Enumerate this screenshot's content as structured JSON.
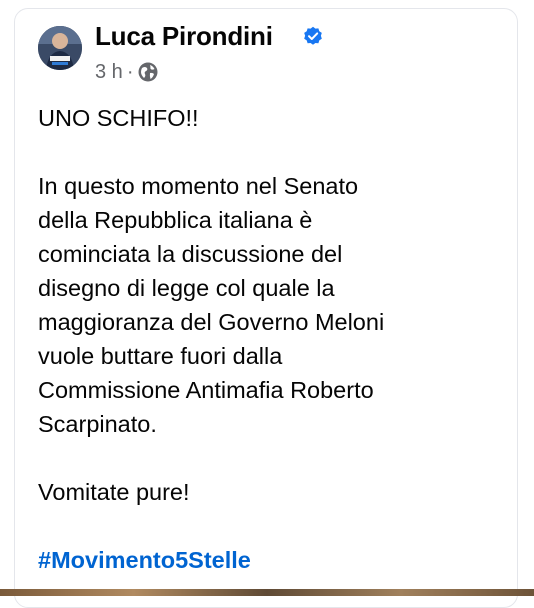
{
  "post": {
    "author": "Luca Pirondini",
    "timestamp": "3 h",
    "separator": "·",
    "verified_color": "#1877f2",
    "audience_icon": "globe-icon",
    "headline": "UNO SCHIFO!!",
    "paragraph_lines": [
      "In questo momento nel Senato",
      "della Repubblica italiana è",
      "cominciata la discussione del",
      "disegno di legge col quale la",
      "maggioranza del Governo Meloni",
      "vuole buttare fuori dalla",
      "Commissione Antimafia Roberto",
      "Scarpinato."
    ],
    "closing": "Vomitate pure!",
    "hashtag": "#Movimento5Stelle",
    "hashtag_color": "#0064d1"
  }
}
